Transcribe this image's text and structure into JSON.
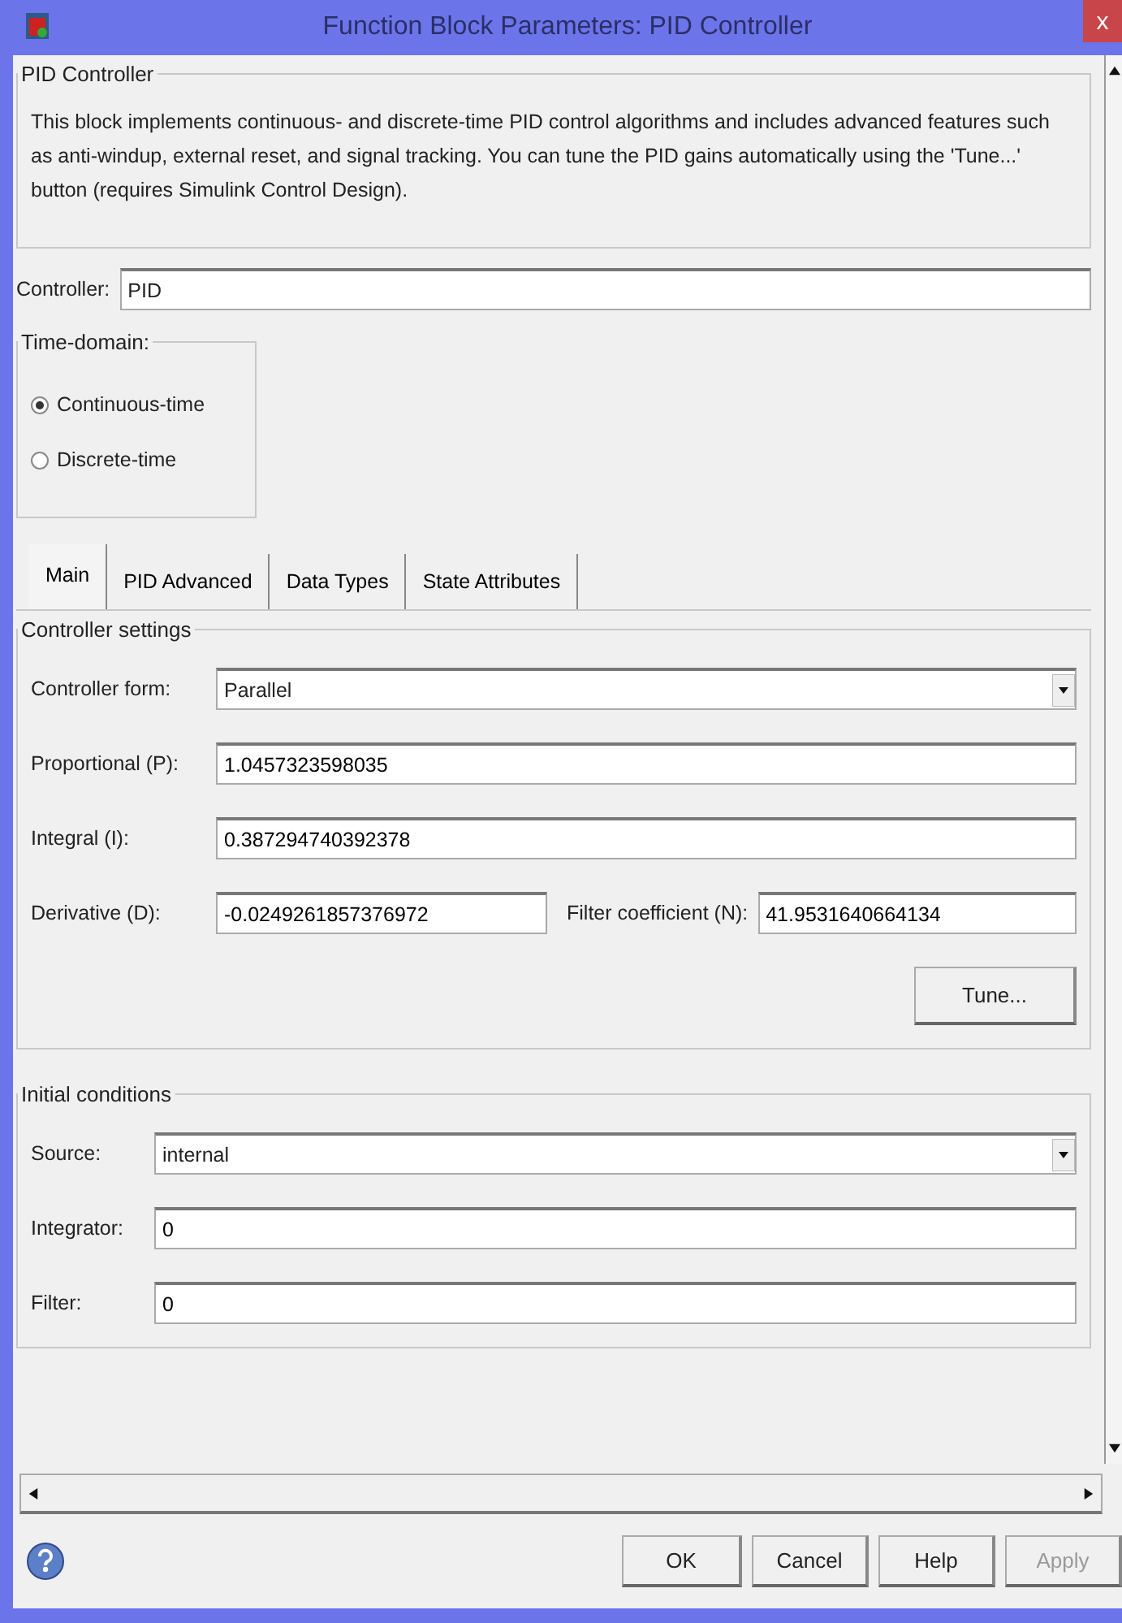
{
  "window": {
    "title": "Function Block Parameters: PID Controller",
    "close": "x"
  },
  "block": {
    "title": "PID Controller",
    "description": "This block implements continuous- and discrete-time PID control algorithms and includes advanced features such as anti-windup, external reset, and signal tracking. You can tune the PID gains automatically using the 'Tune...' button (requires Simulink Control Design)."
  },
  "controller": {
    "label": "Controller:",
    "value": "PID"
  },
  "time_domain": {
    "title": "Time-domain:",
    "options": [
      {
        "label": "Continuous-time",
        "selected": true
      },
      {
        "label": "Discrete-time",
        "selected": false
      }
    ]
  },
  "tabs": [
    {
      "label": "Main",
      "selected": true
    },
    {
      "label": "PID Advanced",
      "selected": false
    },
    {
      "label": "Data Types",
      "selected": false
    },
    {
      "label": "State Attributes",
      "selected": false
    }
  ],
  "controller_settings": {
    "title": "Controller settings",
    "form": {
      "label": "Controller form:",
      "value": "Parallel"
    },
    "gains": [
      {
        "label": "Proportional (P):",
        "value": "1.0457323598035"
      },
      {
        "label": "Integral (I):",
        "value": "0.387294740392378"
      }
    ],
    "derivative": {
      "label": "Derivative (D):",
      "value": "-0.0249261857376972"
    },
    "filter_coefficient": {
      "label": "Filter coefficient (N):",
      "value": "41.9531640664134"
    },
    "tune_button": "Tune..."
  },
  "initial_conditions": {
    "title": "Initial conditions",
    "source": {
      "label": "Source:",
      "value": "internal"
    },
    "fields": [
      {
        "label": "Integrator:",
        "value": "0"
      },
      {
        "label": "Filter:",
        "value": "0"
      }
    ]
  },
  "buttons": [
    {
      "label": "OK",
      "disabled": false
    },
    {
      "label": "Cancel",
      "disabled": false
    },
    {
      "label": "Help",
      "disabled": false
    },
    {
      "label": "Apply",
      "disabled": true
    }
  ]
}
